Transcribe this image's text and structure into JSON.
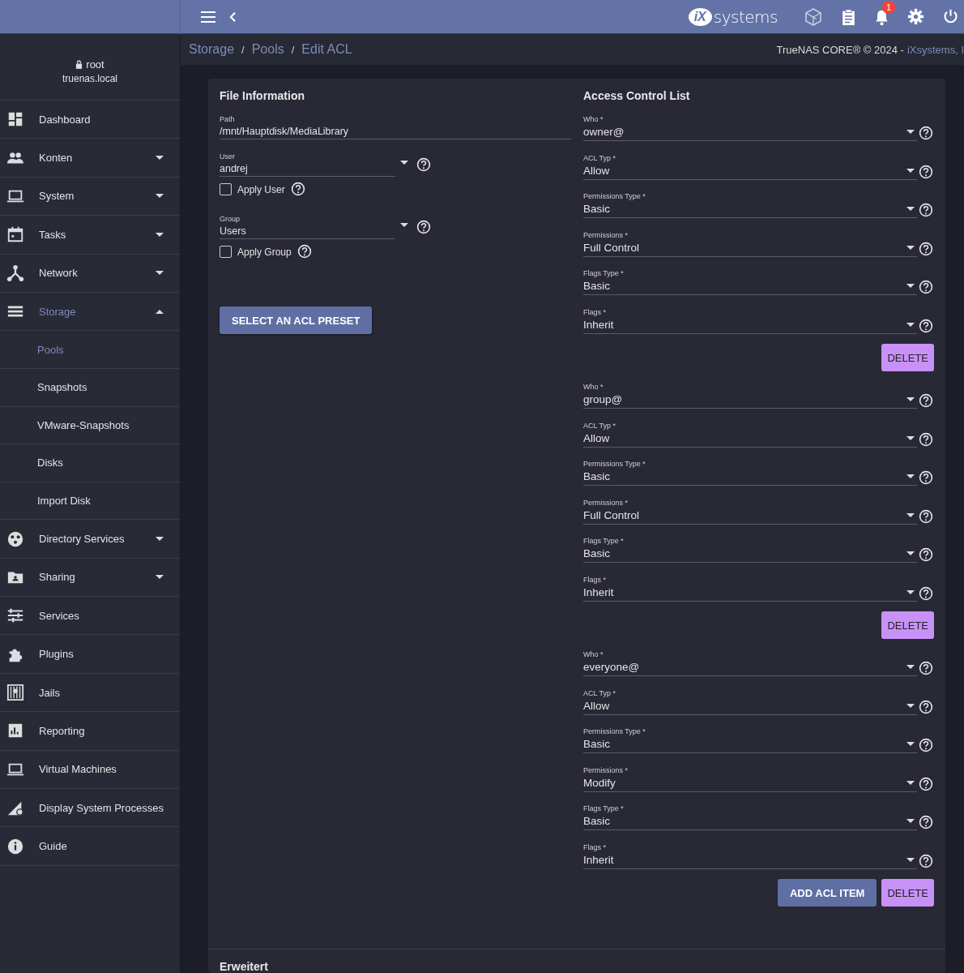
{
  "header": {
    "logo": {
      "mark": "iX",
      "word": "systems"
    },
    "notification_count": "1"
  },
  "breadcrumb": {
    "separator": "/",
    "items": [
      {
        "label": "Storage"
      },
      {
        "label": "Pools"
      },
      {
        "label": "Edit ACL"
      }
    ]
  },
  "copyright": {
    "text": "TrueNAS CORE® © 2024 -",
    "link": "iXsystems, I"
  },
  "user": {
    "name": "root",
    "host": "truenas.local"
  },
  "sidebar": {
    "items": [
      {
        "label": "Dashboard",
        "selected": false
      },
      {
        "label": "Konten",
        "selected": false,
        "expanded": false
      },
      {
        "label": "System",
        "selected": false,
        "expanded": false
      },
      {
        "label": "Tasks",
        "selected": false,
        "expanded": false
      },
      {
        "label": "Network",
        "selected": false,
        "expanded": false
      },
      {
        "label": "Storage",
        "selected": true,
        "expanded": true,
        "children": [
          {
            "label": "Pools",
            "selected": true
          },
          {
            "label": "Snapshots",
            "selected": false
          },
          {
            "label": "VMware-Snapshots",
            "selected": false
          },
          {
            "label": "Disks",
            "selected": false
          },
          {
            "label": "Import Disk",
            "selected": false
          }
        ]
      },
      {
        "label": "Directory Services",
        "selected": false,
        "expanded": false
      },
      {
        "label": "Sharing",
        "selected": false,
        "expanded": false
      },
      {
        "label": "Services",
        "selected": false
      },
      {
        "label": "Plugins",
        "selected": false
      },
      {
        "label": "Jails",
        "selected": false
      },
      {
        "label": "Reporting",
        "selected": false
      },
      {
        "label": "Virtual Machines",
        "selected": false
      },
      {
        "label": "Display System Processes",
        "selected": false
      },
      {
        "label": "Guide",
        "selected": false
      }
    ]
  },
  "file_information": {
    "title": "File Information",
    "path": {
      "label": "Path",
      "value": "/mnt/Hauptdisk/MediaLibrary"
    },
    "user": {
      "label": "User",
      "value": "andrej"
    },
    "apply_user": {
      "label": "Apply User",
      "checked": false
    },
    "group": {
      "label": "Group",
      "value": "Users"
    },
    "apply_group": {
      "label": "Apply Group",
      "checked": false
    },
    "preset_button": "SELECT AN ACL PRESET"
  },
  "acl": {
    "title": "Access Control List",
    "entries": [
      {
        "fields": [
          {
            "label": "Who *",
            "value": "owner@"
          },
          {
            "label": "ACL Typ *",
            "value": "Allow"
          },
          {
            "label": "Permissions Type *",
            "value": "Basic"
          },
          {
            "label": "Permissions *",
            "value": "Full Control"
          },
          {
            "label": "Flags Type *",
            "value": "Basic"
          },
          {
            "label": "Flags *",
            "value": "Inherit"
          }
        ],
        "delete_button": "DELETE"
      },
      {
        "fields": [
          {
            "label": "Who *",
            "value": "group@"
          },
          {
            "label": "ACL Typ *",
            "value": "Allow"
          },
          {
            "label": "Permissions Type *",
            "value": "Basic"
          },
          {
            "label": "Permissions *",
            "value": "Full Control"
          },
          {
            "label": "Flags Type *",
            "value": "Basic"
          },
          {
            "label": "Flags *",
            "value": "Inherit"
          }
        ],
        "delete_button": "DELETE"
      },
      {
        "fields": [
          {
            "label": "Who *",
            "value": "everyone@"
          },
          {
            "label": "ACL Typ *",
            "value": "Allow"
          },
          {
            "label": "Permissions Type *",
            "value": "Basic"
          },
          {
            "label": "Permissions *",
            "value": "Modify"
          },
          {
            "label": "Flags Type *",
            "value": "Basic"
          },
          {
            "label": "Flags *",
            "value": "Inherit"
          }
        ],
        "delete_button": "DELETE"
      }
    ],
    "add_button": "ADD ACL ITEM"
  },
  "advanced": {
    "title": "Erweitert"
  }
}
